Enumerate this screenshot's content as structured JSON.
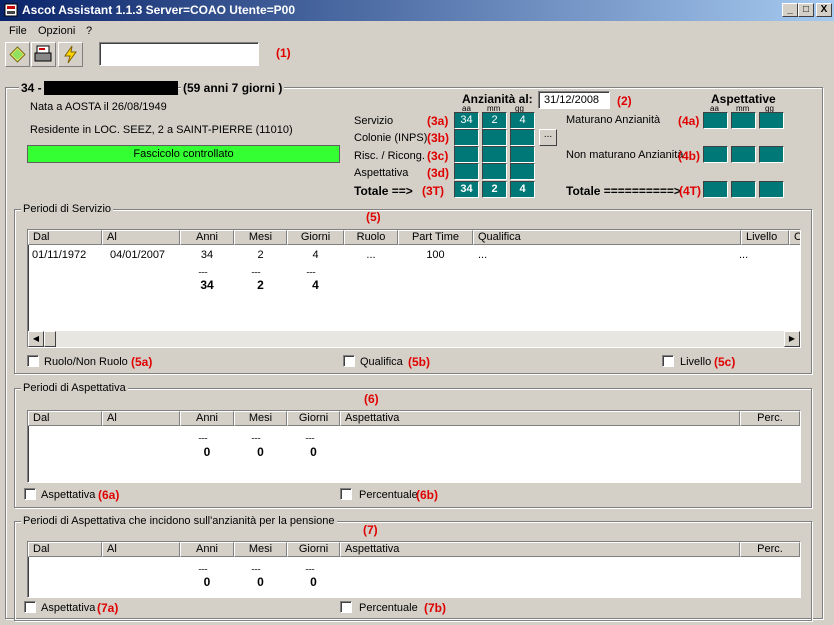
{
  "window": {
    "title": "Ascot Assistant 1.1.3 Server=COAO Utente=P00",
    "minimize": "_",
    "maximize": "□",
    "close": "X"
  },
  "menu": [
    "File",
    "Opzioni",
    "?"
  ],
  "toolbar": {
    "search_value": "",
    "annotation": "(1)"
  },
  "person": {
    "id_prefix": "34 -",
    "age": "(59 anni 7 giorni )",
    "birth": "Nata a AOSTA il 26/08/1949",
    "residence": "Residente in LOC. SEEZ, 2 a SAINT-PIERRE (11010)",
    "status_badge": "Fascicolo controllato",
    "status_color": "#33ff33"
  },
  "anzianita": {
    "label": "Anzianità al:",
    "date": "31/12/2008",
    "date_annotation": "(2)",
    "col_headers": [
      "aa",
      "mm",
      "gg"
    ],
    "rows": [
      {
        "label": "Servizio",
        "tag": "(3a)",
        "values": [
          "34",
          "2",
          "4"
        ]
      },
      {
        "label": "Colonie (INPS)",
        "tag": "(3b)",
        "values": [
          "",
          "",
          ""
        ]
      },
      {
        "label": "Risc. / Ricong.",
        "tag": "(3c)",
        "values": [
          "",
          "",
          ""
        ]
      },
      {
        "label": "Aspettativa",
        "tag": "(3d)",
        "values": [
          "",
          "",
          ""
        ]
      }
    ],
    "total_label": "Totale ==>",
    "total_tag": "(3T)",
    "total_values": [
      "34",
      "2",
      "4"
    ],
    "more_button": "..."
  },
  "aspettative": {
    "title": "Aspettative",
    "col_headers": [
      "aa",
      "mm",
      "gg"
    ],
    "maturano_label": "Maturano Anzianità",
    "maturano_tag": "(4a)",
    "non_maturano_label": "Non maturano Anzianità",
    "non_maturano_tag": "(4b)",
    "total_label": "Totale ==========>",
    "total_tag": "(4T)"
  },
  "servizio": {
    "group_title": "Periodi di Servizio",
    "annotation": "(5)",
    "columns": [
      "Dal",
      "Al",
      "Anni",
      "Mesi",
      "Giorni",
      "Ruolo",
      "Part Time",
      "Qualifica",
      "Livello",
      "Co"
    ],
    "rows": [
      {
        "dal": "01/11/1972",
        "al": "04/01/2007",
        "anni": "34",
        "mesi": "2",
        "giorni": "4",
        "ruolo": "...",
        "part_time": "100",
        "qualifica": "...",
        "livello": "..."
      }
    ],
    "dots": "......",
    "totals": {
      "anni": "34",
      "mesi": "2",
      "giorni": "4"
    },
    "checks": [
      {
        "label": "Ruolo/Non Ruolo",
        "tag": "(5a)"
      },
      {
        "label": "Qualifica",
        "tag": "(5b)"
      },
      {
        "label": "Livello",
        "tag": "(5c)"
      }
    ]
  },
  "aspettativa": {
    "group_title": "Periodi di Aspettativa",
    "annotation": "(6)",
    "columns": [
      "Dal",
      "Al",
      "Anni",
      "Mesi",
      "Giorni",
      "Aspettativa",
      "Perc."
    ],
    "dots": "......",
    "totals": {
      "anni": "0",
      "mesi": "0",
      "giorni": "0"
    },
    "checks": [
      {
        "label": "Aspettativa",
        "tag": "(6a)"
      },
      {
        "label": "Percentuale",
        "tag": "(6b)"
      }
    ]
  },
  "pensione": {
    "group_title": "Periodi di Aspettativa che incidono sull'anzianità per la pensione",
    "annotation": "(7)",
    "columns": [
      "Dal",
      "Al",
      "Anni",
      "Mesi",
      "Giorni",
      "Aspettativa",
      "Perc."
    ],
    "dots": "......",
    "totals": {
      "anni": "0",
      "mesi": "0",
      "giorni": "0"
    },
    "checks": [
      {
        "label": "Aspettativa",
        "tag": "(7a)"
      },
      {
        "label": "Percentuale",
        "tag": "(7b)"
      }
    ]
  }
}
